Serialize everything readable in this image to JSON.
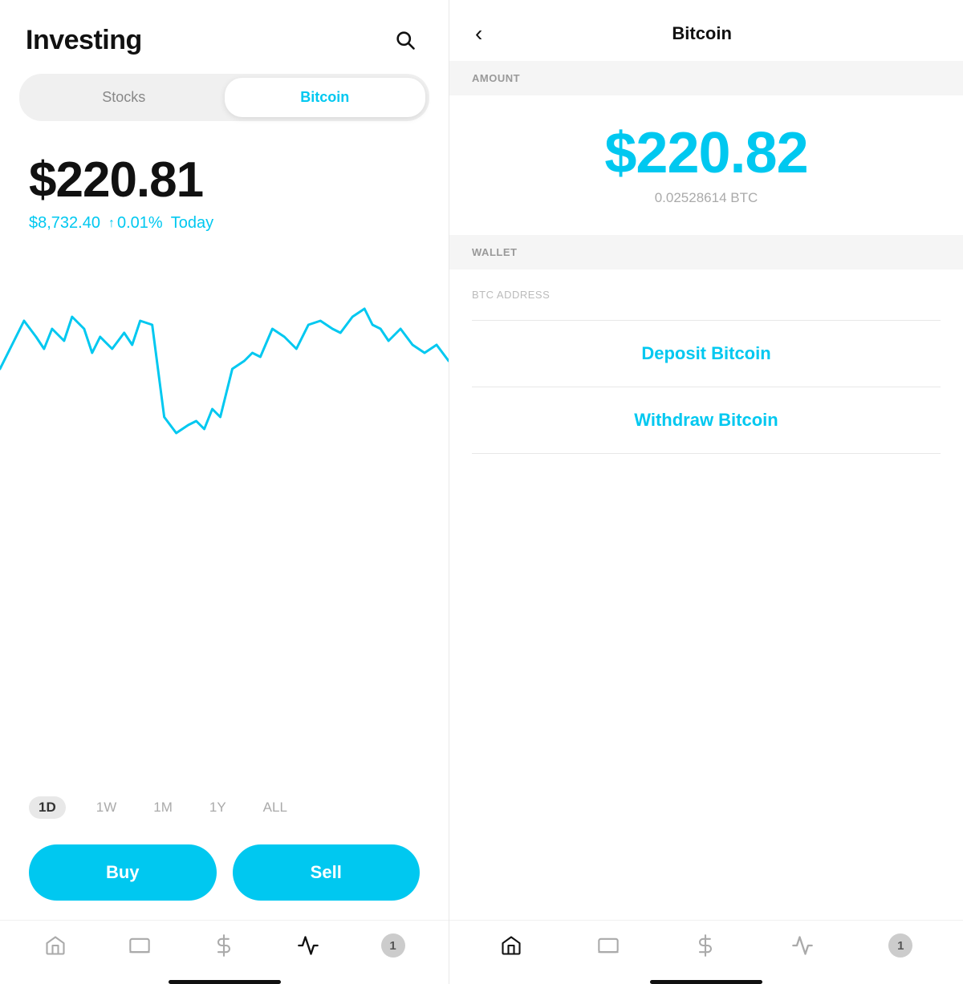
{
  "left": {
    "title": "Investing",
    "tabs": [
      {
        "label": "Stocks",
        "active": false
      },
      {
        "label": "Bitcoin",
        "active": true
      }
    ],
    "price": {
      "main": "$220.81",
      "sub": "$8,732.40",
      "change": "0.01%",
      "period": "Today"
    },
    "timeRanges": [
      {
        "label": "1D",
        "selected": true
      },
      {
        "label": "1W",
        "selected": false
      },
      {
        "label": "1M",
        "selected": false
      },
      {
        "label": "1Y",
        "selected": false
      },
      {
        "label": "ALL",
        "selected": false
      }
    ],
    "buttons": {
      "buy": "Buy",
      "sell": "Sell"
    },
    "nav": {
      "items": [
        {
          "icon": "home-icon",
          "active": false
        },
        {
          "icon": "tv-icon",
          "active": false
        },
        {
          "icon": "dollar-icon",
          "active": false
        },
        {
          "icon": "activity-icon",
          "active": true
        },
        {
          "icon": "bell-icon",
          "active": false
        }
      ]
    }
  },
  "right": {
    "title": "Bitcoin",
    "back_label": "‹",
    "amount_label": "AMOUNT",
    "amount_usd": "$220.82",
    "amount_btc": "0.02528614 BTC",
    "wallet_label": "WALLET",
    "btc_address_label": "BTC ADDRESS",
    "deposit_label": "Deposit Bitcoin",
    "withdraw_label": "Withdraw Bitcoin",
    "nav": {
      "items": [
        {
          "icon": "home-icon",
          "active": true
        },
        {
          "icon": "tv-icon",
          "active": false
        },
        {
          "icon": "dollar-icon",
          "active": false
        },
        {
          "icon": "activity-icon",
          "active": false
        },
        {
          "icon": "bell-icon",
          "active": false
        }
      ]
    }
  }
}
